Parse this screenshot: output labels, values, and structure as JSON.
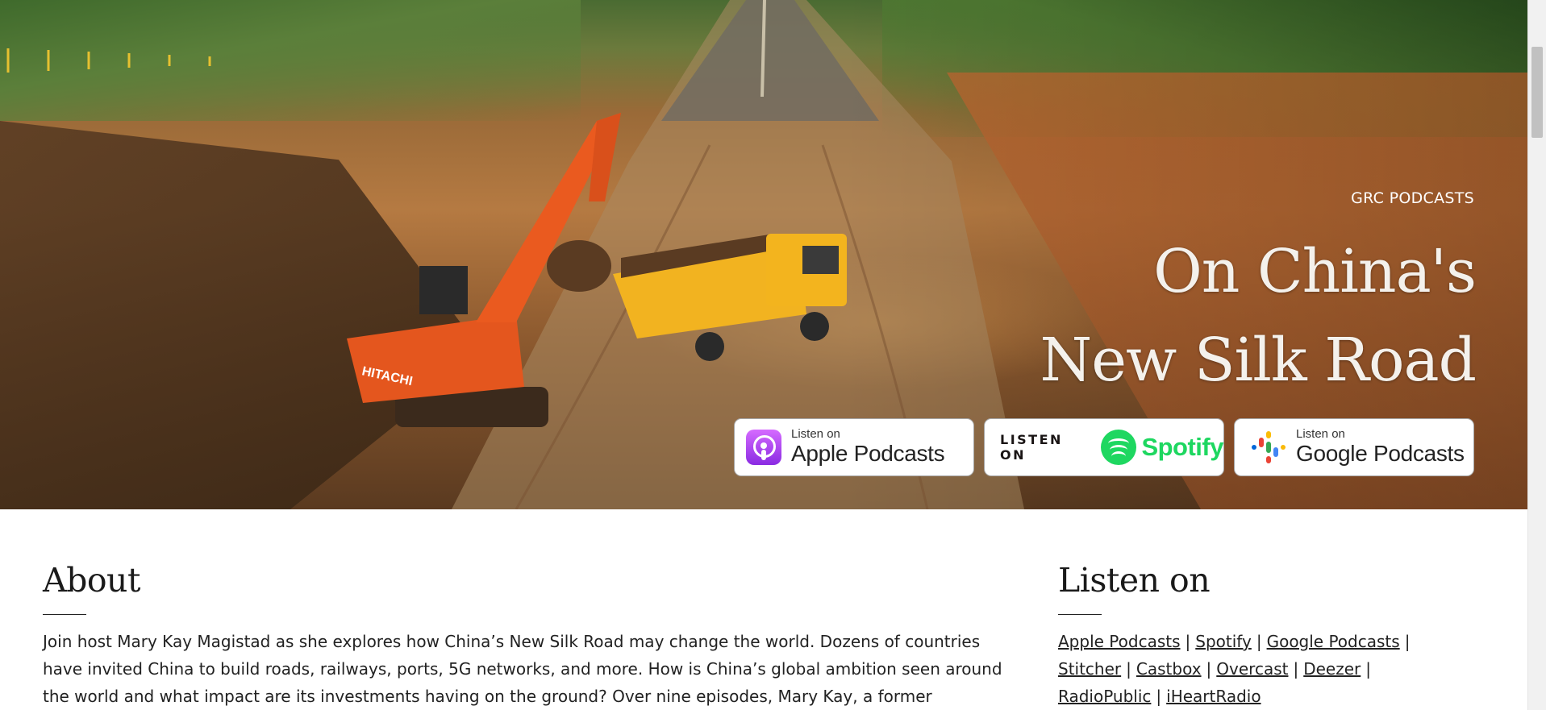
{
  "hero": {
    "kicker": "GRC PODCASTS",
    "title_line1": "On China's",
    "title_line2": "New Silk Road",
    "badges": {
      "apple": {
        "small": "Listen on",
        "big": "Apple Podcasts"
      },
      "spotify": {
        "listen": "LISTEN ON",
        "word": "Spotify"
      },
      "google": {
        "small": "Listen on",
        "big": "Google Podcasts"
      }
    }
  },
  "about": {
    "heading": "About",
    "text": "Join host Mary Kay Magistad as she explores how China’s New Silk Road may change the world. Dozens of countries have invited China to build roads, railways, ports, 5G networks, and more. How is China’s global ambition seen around the world and what impact are its investments having on the ground? Over nine episodes, Mary Kay, a former"
  },
  "listen": {
    "heading": "Listen on",
    "links": [
      "Apple Podcasts",
      "Spotify",
      "Google Podcasts",
      "Stitcher",
      "Castbox",
      "Overcast",
      "Deezer",
      "RadioPublic",
      "iHeartRadio"
    ],
    "separator": "|"
  },
  "colors": {
    "spotify_green": "#1ed760",
    "apple_purple": "#8a2be2",
    "text": "#222222"
  },
  "icons": [
    "apple-podcasts-icon",
    "spotify-icon",
    "google-podcasts-icon"
  ]
}
